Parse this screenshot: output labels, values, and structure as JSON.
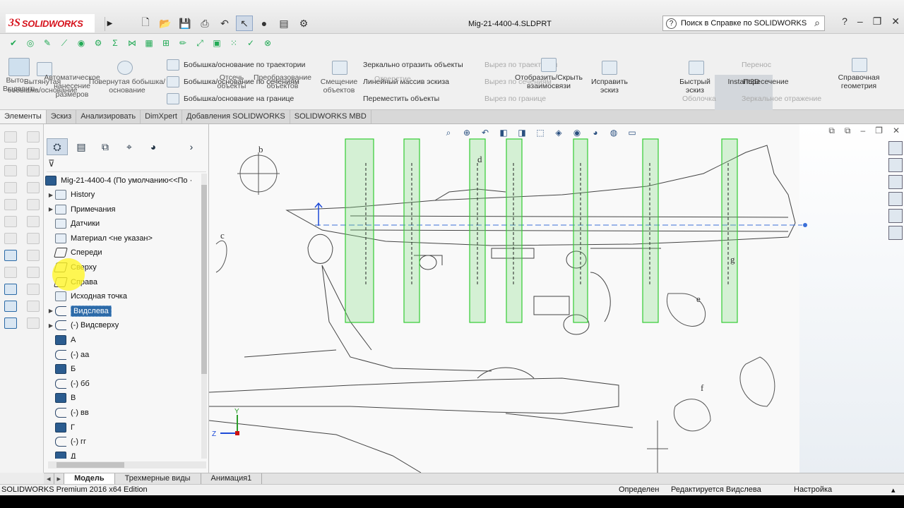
{
  "app": {
    "brand": "SOLIDWORKS",
    "document_title": "Mig-21-4400-4.SLDPRT",
    "help_search_text": "Поиск в Справке по SOLIDWORKS",
    "window_controls": [
      "?",
      "–",
      "❐",
      "✕"
    ]
  },
  "ribbon": {
    "extrude": "Выто.. Выдавить",
    "boss_extrude": "Вытянутая бобышка/основание",
    "auto_dims": "Автоматическое нанесение размеров",
    "revolve": "Повернутая бобышка/основание",
    "sweep": "Бобышка/основание по траектории",
    "loft": "Бобышка/основание по сечениям",
    "boundary": "Бобышка/основание на границе",
    "offset": "Отсечь объекты",
    "convert": "Преобразование объектов",
    "offset_entities": "Смещение объектов",
    "mirror": "Зеркально отразить объекты",
    "linear_pattern": "Линейный массив эскиза",
    "move": "Переместить объекты",
    "sweep_cut": "Вырез по траектории",
    "hole": "Отверстие",
    "cut_loft": "Вырез по сечениям",
    "cut_boundary": "Вырез по границе",
    "show_hide": "Отобразить/Скрыть взаимосвязи",
    "repair": "Исправить эскиз",
    "quick_sketch": "Быстрый эскиз",
    "instant2d": "Instant2D",
    "intersection": "Пересечение",
    "reference_geometry": "Справочная геометрия",
    "carry": "Перенос",
    "mirror_mirror": "Зеркальное отражение",
    "shell": "Оболочка"
  },
  "tabs": [
    {
      "label": "Элементы",
      "active": true
    },
    {
      "label": "Эскиз",
      "active": false
    },
    {
      "label": "Анализировать",
      "active": false
    },
    {
      "label": "DimXpert",
      "active": false
    },
    {
      "label": "Добавления SOLIDWORKS",
      "active": false
    },
    {
      "label": "SOLIDWORKS MBD",
      "active": false
    }
  ],
  "tree": {
    "root": "Mig-21-4400-4  (По умолчанию<<По ·",
    "items": [
      {
        "label": "History",
        "icon": "folder-icon",
        "expand": true,
        "type": "folder"
      },
      {
        "label": "Примечания",
        "icon": "annotation-icon",
        "expand": true,
        "type": "folder"
      },
      {
        "label": "Датчики",
        "icon": "sensor-icon",
        "expand": false,
        "type": "folder"
      },
      {
        "label": "Материал <не указан>",
        "icon": "material-icon",
        "expand": false,
        "type": "folder"
      },
      {
        "label": "Спереди",
        "icon": "plane-icon",
        "expand": false,
        "type": "plane"
      },
      {
        "label": "Сверху",
        "icon": "plane-icon",
        "expand": false,
        "type": "plane"
      },
      {
        "label": "Справа",
        "icon": "plane-icon",
        "expand": false,
        "type": "plane"
      },
      {
        "label": "Исходная точка",
        "icon": "origin-icon",
        "expand": false,
        "type": "origin"
      },
      {
        "label": "Видслева",
        "icon": "sketch-icon",
        "expand": true,
        "type": "sketch",
        "selected": true
      },
      {
        "label": "(-) Видсверху",
        "icon": "sketch-icon",
        "expand": true,
        "type": "sketch"
      },
      {
        "label": "А",
        "icon": "body-icon",
        "expand": false,
        "type": "body"
      },
      {
        "label": "(-) аа",
        "icon": "sketch-icon",
        "expand": false,
        "type": "sketch"
      },
      {
        "label": "Б",
        "icon": "body-icon",
        "expand": false,
        "type": "body"
      },
      {
        "label": "(-) бб",
        "icon": "sketch-icon",
        "expand": false,
        "type": "sketch"
      },
      {
        "label": "В",
        "icon": "body-icon",
        "expand": false,
        "type": "body"
      },
      {
        "label": "(-) вв",
        "icon": "sketch-icon",
        "expand": false,
        "type": "sketch"
      },
      {
        "label": "Г",
        "icon": "body-icon",
        "expand": false,
        "type": "body"
      },
      {
        "label": "(-) гг",
        "icon": "sketch-icon",
        "expand": false,
        "type": "sketch"
      },
      {
        "label": "Д",
        "icon": "body-icon",
        "expand": false,
        "type": "body"
      }
    ]
  },
  "bottom_tabs": [
    {
      "label": "Модель",
      "active": true
    },
    {
      "label": "Трехмерные виды",
      "active": false
    },
    {
      "label": "Анимация1",
      "active": false
    }
  ],
  "status": {
    "edition": "SOLIDWORKS Premium 2016 x64 Edition",
    "state": "Определен",
    "editing": "Редактируется Видслева",
    "settings": "Настройка"
  },
  "drawing": {
    "section_letters": [
      "b",
      "c",
      "e",
      "d",
      "f",
      "g"
    ],
    "triad_labels": [
      "Y",
      "Z"
    ]
  },
  "colors": {
    "brand_red": "#d6121c",
    "selection_blue": "#2c6aa8",
    "plane_green": "#33cc33"
  }
}
